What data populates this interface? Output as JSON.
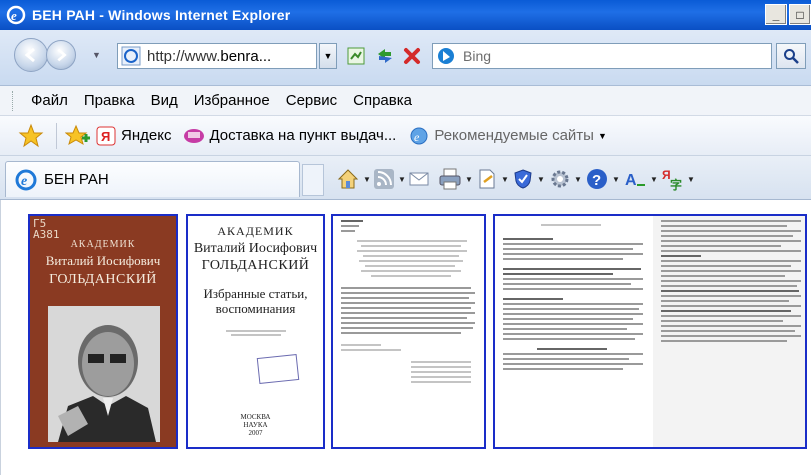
{
  "window": {
    "title": "БЕН РАН - Windows Internet Explorer",
    "buttons": {
      "minimize": "_",
      "maximize": "□"
    }
  },
  "address": {
    "url_prefix": "http://www.",
    "url_host": "benra...",
    "search_placeholder": "Bing"
  },
  "menu": {
    "items": [
      "Файл",
      "Правка",
      "Вид",
      "Избранное",
      "Сервис",
      "Справка"
    ]
  },
  "favorites": {
    "links": [
      {
        "label": "Яндекс",
        "icon": "yandex-icon"
      },
      {
        "label": "Доставка на пункт выдач...",
        "icon": "delivery-icon"
      },
      {
        "label": "Рекомендуемые сайты",
        "icon": "suggested-sites-icon"
      }
    ]
  },
  "tab": {
    "label": "БЕН РАН"
  },
  "thumbnails": {
    "cover": {
      "code_line1": "Г5",
      "code_line2": "А381",
      "academician": "АКАДЕМИК",
      "name": "Виталий Иосифович",
      "surname": "ГОЛЬДАНСКИЙ"
    },
    "title_page": {
      "academician": "АКАДЕМИК",
      "name": "Виталий Иосифович",
      "surname": "ГОЛЬДАНСКИЙ",
      "work_line1": "Избранные статьи,",
      "work_line2": "воспоминания",
      "publisher_line1": "МОСКВА",
      "publisher_line2": "НАУКА",
      "year": "2007"
    }
  },
  "colors": {
    "titlebar": "#0a5bd6",
    "thumb_border": "#1a2dc8",
    "cover_bg": "#8a3a22"
  }
}
